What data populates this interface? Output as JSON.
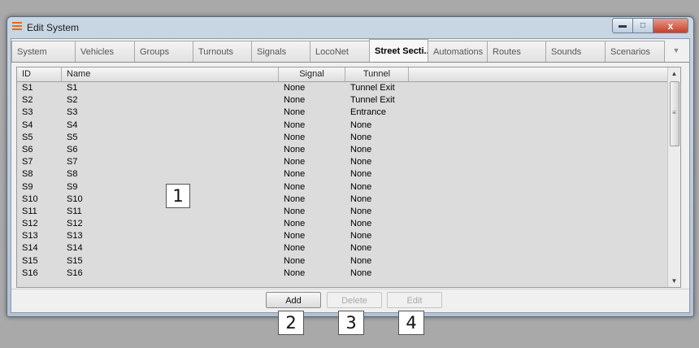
{
  "window": {
    "title": "Edit System",
    "close_glyph": "x"
  },
  "tabs": [
    {
      "label": "System",
      "active": false
    },
    {
      "label": "Vehicles",
      "active": false
    },
    {
      "label": "Groups",
      "active": false
    },
    {
      "label": "Turnouts",
      "active": false
    },
    {
      "label": "Signals",
      "active": false
    },
    {
      "label": "LocoNet",
      "active": false
    },
    {
      "label": "Street Secti...",
      "active": true
    },
    {
      "label": "Automations",
      "active": false
    },
    {
      "label": "Routes",
      "active": false
    },
    {
      "label": "Sounds",
      "active": false
    },
    {
      "label": "Scenarios",
      "active": false
    }
  ],
  "grid": {
    "columns": [
      "ID",
      "Name",
      "Signal",
      "Tunnel"
    ],
    "rows": [
      [
        "S1",
        "S1",
        "None",
        "Tunnel Exit"
      ],
      [
        "S2",
        "S2",
        "None",
        "Tunnel Exit"
      ],
      [
        "S3",
        "S3",
        "None",
        "Entrance"
      ],
      [
        "S4",
        "S4",
        "None",
        "None"
      ],
      [
        "S5",
        "S5",
        "None",
        "None"
      ],
      [
        "S6",
        "S6",
        "None",
        "None"
      ],
      [
        "S7",
        "S7",
        "None",
        "None"
      ],
      [
        "S8",
        "S8",
        "None",
        "None"
      ],
      [
        "S9",
        "S9",
        "None",
        "None"
      ],
      [
        "S10",
        "S10",
        "None",
        "None"
      ],
      [
        "S11",
        "S11",
        "None",
        "None"
      ],
      [
        "S12",
        "S12",
        "None",
        "None"
      ],
      [
        "S13",
        "S13",
        "None",
        "None"
      ],
      [
        "S14",
        "S14",
        "None",
        "None"
      ],
      [
        "S15",
        "S15",
        "None",
        "None"
      ],
      [
        "S16",
        "S16",
        "None",
        "None"
      ]
    ]
  },
  "buttons": {
    "add": "Add",
    "delete": "Delete",
    "edit": "Edit"
  },
  "callouts": {
    "grid": "1",
    "add": "2",
    "delete": "3",
    "edit": "4"
  },
  "colors": {
    "accent_icon": "#e86b12",
    "close_button": "#c6412b"
  }
}
